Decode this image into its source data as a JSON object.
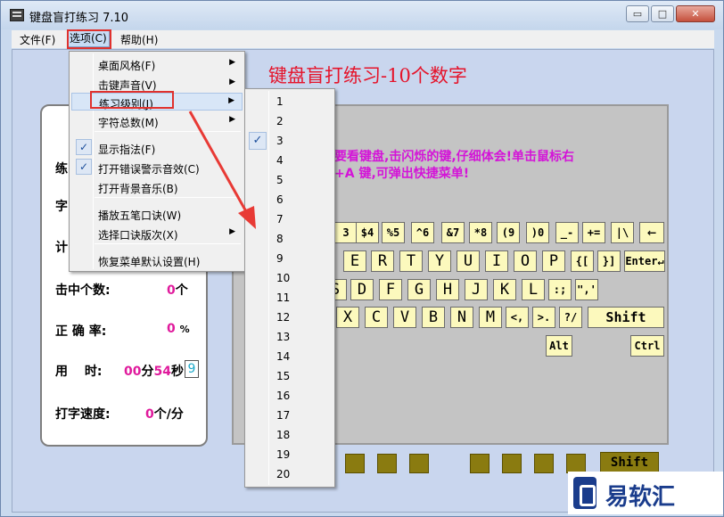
{
  "window": {
    "title": "键盘盲打练习 7.10",
    "min_label": "▭",
    "max_label": "□",
    "close_label": "✕"
  },
  "menubar": {
    "file": "文件(F)",
    "options": "选项(C)",
    "help": "帮助(H)"
  },
  "options_menu": {
    "items": [
      {
        "label": "桌面风格(F)",
        "submenu": true
      },
      {
        "label": "击键声音(V)",
        "submenu": true
      },
      {
        "label": "练习级别(J)",
        "submenu": true
      },
      {
        "label": "字符总数(M)",
        "submenu": true
      },
      {
        "label": "显示指法(F)",
        "checked": true
      },
      {
        "label": "打开错误警示音效(C)",
        "checked": true
      },
      {
        "label": "打开背景音乐(B)"
      },
      {
        "label": "播放五笔口诀(W)"
      },
      {
        "label": "选择口诀版次(X)",
        "submenu": true
      },
      {
        "label": "恢复菜单默认设置(H)"
      }
    ]
  },
  "level_submenu": {
    "items": [
      "1",
      "2",
      "3",
      "4",
      "5",
      "6",
      "7",
      "8",
      "9",
      "10",
      "11",
      "12",
      "13",
      "14",
      "15",
      "16",
      "17",
      "18",
      "19",
      "20"
    ],
    "checked": "3"
  },
  "main": {
    "heading": "键盘盲打练习-10个数字",
    "hint_line1": "要看键盘,击闪烁的键,仔细体会!单击鼠标右",
    "hint_line2": "+A 键,可弹出快捷菜单!"
  },
  "stats": {
    "partial1": "练",
    "partial2": "字",
    "partial3": "计",
    "hits_label": "击中个数:",
    "hits_value": "0",
    "hits_unit": "个",
    "accuracy_label": "正 确 率:",
    "accuracy_value": "0",
    "accuracy_unit": "%",
    "time_label": "用　 时:",
    "time_min": "00",
    "time_min_unit": "分",
    "time_sec": "54",
    "time_sec_unit": "秒",
    "time_box": "9",
    "speed_label": "打字速度:",
    "speed_value": "0",
    "speed_unit": "个/分"
  },
  "keyboard": {
    "row_numbers": [
      "3",
      "$4",
      "%5",
      "^6",
      "&7",
      "*8",
      "(9",
      ")0",
      "_-",
      "+=",
      "|\\",
      "←"
    ],
    "row_top": [
      "E",
      "R",
      "T",
      "Y",
      "U",
      "I",
      "O",
      "P",
      "{[",
      "}]",
      "Enter↵"
    ],
    "row_home": [
      "S",
      "D",
      "F",
      "G",
      "H",
      "J",
      "K",
      "L",
      ":;",
      "\",'"
    ],
    "row_bottom": [
      "X",
      "C",
      "V",
      "B",
      "N",
      "M",
      "<,",
      ">.",
      "?/",
      "Shift"
    ],
    "row_space": [
      "Alt",
      "Ctrl"
    ],
    "bottom_shift": "Shift"
  },
  "watermark": {
    "text": "易软汇"
  },
  "colors": {
    "heading": "#e5132a",
    "hint": "#d414d8",
    "stat_value": "#e01a9c",
    "key_face": "#fcf9bd",
    "highlight_box": "#e0312d"
  }
}
